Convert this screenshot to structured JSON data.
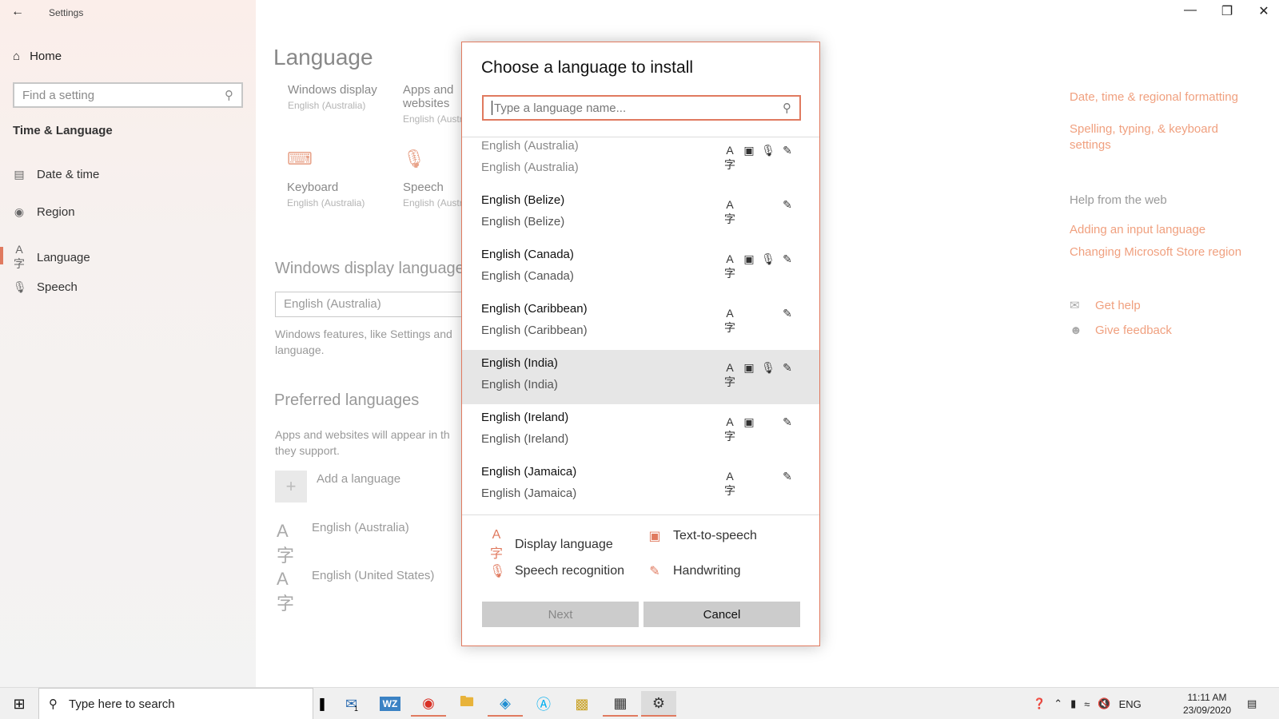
{
  "window": {
    "title": "Settings",
    "back_icon": "back-arrow-icon",
    "minimize": "—",
    "restore": "❐",
    "close": "✕"
  },
  "nav": {
    "home": "Home",
    "search_placeholder": "Find a setting",
    "section": "Time & Language",
    "items": [
      {
        "label": "Date & time",
        "icon": "calendar-clock-icon"
      },
      {
        "label": "Region",
        "icon": "globe-icon"
      },
      {
        "label": "Language",
        "icon": "language-icon"
      },
      {
        "label": "Speech",
        "icon": "microphone-icon"
      }
    ]
  },
  "main": {
    "title": "Language",
    "tiles": [
      {
        "title": "Windows display",
        "value": "English (Australia)"
      },
      {
        "title": "Apps and websites",
        "value": "English (Austr"
      },
      {
        "title": "Keyboard",
        "value": "English (Australia)"
      },
      {
        "title": "Speech",
        "value": "English (Austr"
      }
    ],
    "display_language_heading": "Windows display language",
    "display_language_value": "English (Australia)",
    "display_language_desc_1": "Windows features, like Settings and",
    "display_language_desc_2": "language.",
    "preferred_heading": "Preferred languages",
    "preferred_desc_1": "Apps and websites will appear in th",
    "preferred_desc_2": "they support.",
    "add_language": "Add a language",
    "preferred_items": [
      "English (Australia)",
      "English (United States)"
    ]
  },
  "right": {
    "links": [
      "Date, time & regional formatting",
      "Spelling, typing, & keyboard",
      "settings"
    ],
    "help_heading": "Help from the web",
    "help_links": [
      "Adding an input language",
      "Changing Microsoft Store region"
    ],
    "get_help": "Get help",
    "give_feedback": "Give feedback"
  },
  "dialog": {
    "title": "Choose a language to install",
    "search_placeholder": "Type a language name...",
    "languages": [
      {
        "name": "English (Australia)",
        "native": "English (Australia)",
        "features": [
          "display",
          "tts",
          "speech",
          "handwriting"
        ]
      },
      {
        "name": "English (Belize)",
        "native": "English (Belize)",
        "features": [
          "display",
          "handwriting"
        ]
      },
      {
        "name": "English (Canada)",
        "native": "English (Canada)",
        "features": [
          "display",
          "tts",
          "speech",
          "handwriting"
        ]
      },
      {
        "name": "English (Caribbean)",
        "native": "English (Caribbean)",
        "features": [
          "display",
          "handwriting"
        ]
      },
      {
        "name": "English (India)",
        "native": "English (India)",
        "features": [
          "display",
          "tts",
          "speech",
          "handwriting"
        ]
      },
      {
        "name": "English (Ireland)",
        "native": "English (Ireland)",
        "features": [
          "display",
          "tts",
          "handwriting"
        ]
      },
      {
        "name": "English (Jamaica)",
        "native": "English (Jamaica)",
        "features": [
          "display",
          "handwriting"
        ]
      }
    ],
    "legend": {
      "display": "Display language",
      "tts": "Text-to-speech",
      "speech": "Speech recognition",
      "handwriting": "Handwriting"
    },
    "next": "Next",
    "cancel": "Cancel"
  },
  "taskbar": {
    "search_placeholder": "Type here to search",
    "tray_lang": "ENG",
    "time": "11:11 AM",
    "date": "23/09/2020",
    "mail_badge": "1"
  },
  "colors": {
    "accent": "#e07a5f",
    "link": "#f0a07f"
  }
}
